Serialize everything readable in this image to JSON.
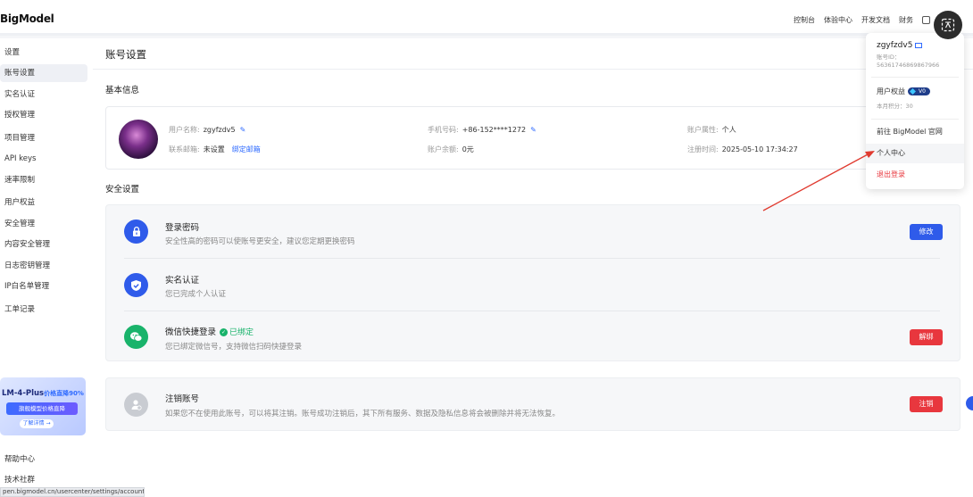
{
  "brand": "BigModel",
  "topnav": [
    "控制台",
    "体验中心",
    "开发文档",
    "财务"
  ],
  "sidebar": {
    "items": [
      "设置",
      "账号设置",
      "实名认证",
      "授权管理",
      "项目管理",
      "API keys",
      "速率限制",
      "用户权益",
      "安全管理",
      "内容安全管理",
      "日志密钥管理",
      "IP白名单管理",
      "工单记录"
    ],
    "active_index": 1,
    "bottom": [
      "帮助中心",
      "技术社群"
    ],
    "promo": {
      "title": "LM-4-Plus",
      "highlight": "价格直降90%",
      "button": "旗舰模型价格直降",
      "link": "了解详情 →"
    }
  },
  "page": {
    "title": "账号设置",
    "basic_section": "基本信息",
    "basic": {
      "username_label": "用户名称:",
      "username": "zgyfzdv5",
      "email_label": "联系邮箱:",
      "email": "未设置",
      "bind_email": "绑定邮箱",
      "phone_label": "手机号码:",
      "phone": "+86-152****1272",
      "balance_label": "账户余额:",
      "balance": "0元",
      "attr_label": "账户属性:",
      "attr": "个人",
      "reg_label": "注册时间:",
      "reg": "2025-05-10 17:34:27"
    },
    "security_section": "安全设置",
    "security": [
      {
        "title": "登录密码",
        "desc": "安全性高的密码可以使账号更安全，建议您定期更换密码",
        "button": "修改"
      },
      {
        "title": "实名认证",
        "desc": "您已完成个人认证"
      },
      {
        "title": "微信快捷登录",
        "badge": "已绑定",
        "desc": "您已绑定微信号，支持微信扫码快捷登录",
        "button": "解绑"
      }
    ],
    "cancel": {
      "title": "注销账号",
      "desc": "如果您不在使用此账号，可以将其注销。账号成功注销后，其下所有服务、数据及隐私信息将会被删除并将无法恢复。",
      "button": "注销"
    }
  },
  "dropdown": {
    "username": "zgyfzdv5",
    "id_label": "账号ID：",
    "id": "56361746869867966",
    "rights_label": "用户权益",
    "vip": "V0",
    "points": "本月积分：30",
    "items": [
      "前往 BigModel 官网",
      "个人中心",
      "退出登录"
    ]
  },
  "status_url": "pen.bigmodel.cn/usercenter/settings/account",
  "colors": {
    "primary": "#2f5bea",
    "danger": "#e8373e",
    "success": "#19b36b",
    "annotation": "#e03a2f"
  }
}
